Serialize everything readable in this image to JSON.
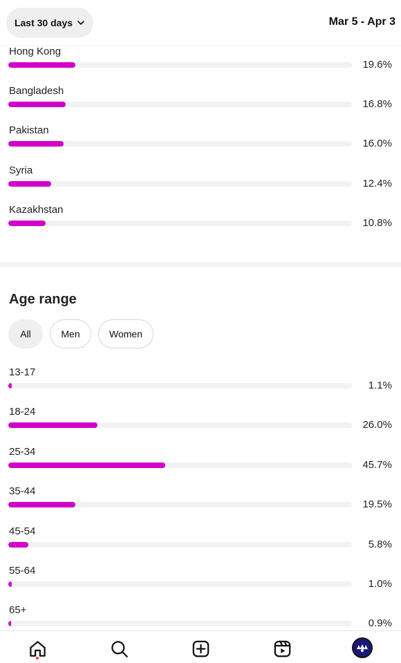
{
  "header": {
    "range_label": "Last 30 days",
    "date_range": "Mar 5 - Apr 3"
  },
  "countries": [
    {
      "label": "Hong Kong",
      "value": "19.6%",
      "fraction": 0.196
    },
    {
      "label": "Bangladesh",
      "value": "16.8%",
      "fraction": 0.168
    },
    {
      "label": "Pakistan",
      "value": "16.0%",
      "fraction": 0.16
    },
    {
      "label": "Syria",
      "value": "12.4%",
      "fraction": 0.124
    },
    {
      "label": "Kazakhstan",
      "value": "10.8%",
      "fraction": 0.108
    }
  ],
  "age": {
    "title": "Age range",
    "filters": [
      "All",
      "Men",
      "Women"
    ],
    "selected_filter": "All",
    "rows": [
      {
        "label": "13-17",
        "value": "1.1%",
        "fraction": 0.011
      },
      {
        "label": "18-24",
        "value": "26.0%",
        "fraction": 0.26
      },
      {
        "label": "25-34",
        "value": "45.7%",
        "fraction": 0.457
      },
      {
        "label": "35-44",
        "value": "19.5%",
        "fraction": 0.195
      },
      {
        "label": "45-54",
        "value": "5.8%",
        "fraction": 0.058
      },
      {
        "label": "55-64",
        "value": "1.0%",
        "fraction": 0.01
      },
      {
        "label": "65+",
        "value": "0.9%",
        "fraction": 0.009
      }
    ]
  },
  "colors": {
    "bar": "#d200c8",
    "track": "#f2f2f4",
    "notification": "#ff3040"
  },
  "nav": {
    "icons": [
      "home-icon",
      "search-icon",
      "create-icon",
      "reels-icon",
      "profile-avatar"
    ]
  }
}
